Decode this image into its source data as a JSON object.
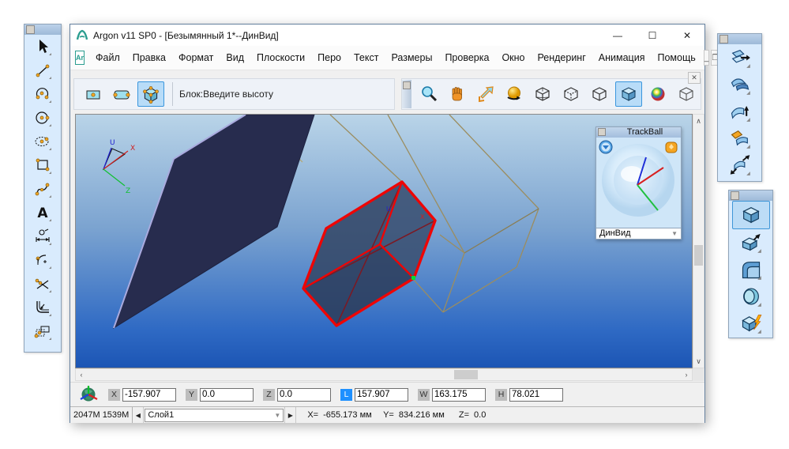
{
  "window": {
    "title": "Argon v11 SP0 - [Безымянный 1*--ДинВид]",
    "controls": {
      "minimize": "—",
      "maximize": "☐",
      "close": "✕"
    }
  },
  "menu": {
    "doc_icon_text": "Ar",
    "items": [
      "Файл",
      "Правка",
      "Формат",
      "Вид",
      "Плоскости",
      "Перо",
      "Текст",
      "Размеры",
      "Проверка",
      "Окно",
      "Рендеринг",
      "Анимация",
      "Помощь"
    ],
    "mdi_minimize": "_",
    "mdi_restore": "❐",
    "mdi_close": "✕"
  },
  "toolbar": {
    "creation_tools": [
      "point-block-icon",
      "two-point-block-icon",
      "block-cube-icon"
    ],
    "selected_creation_tool": "block-cube-icon",
    "prompt": "Блок:Введите высоту",
    "view_tools": [
      "zoom-icon",
      "pan-hand-icon",
      "dynamic-zoom-icon",
      "orbit-icon",
      "wireframe-cube-icon",
      "hidden-line-cube-icon",
      "outline-cube-icon",
      "shaded-cube-icon",
      "render-sphere-icon",
      "ghost-cube-icon"
    ],
    "selected_view_tool": "shaded-cube-icon"
  },
  "left_palette": {
    "tools": [
      "select",
      "line",
      "arc",
      "circle",
      "ellipse",
      "rectangle",
      "spline",
      "text",
      "dimension",
      "curve-edit",
      "trim",
      "fillet",
      "select-region"
    ]
  },
  "right_palette_top": {
    "tools": [
      "extrude-sheet",
      "cover-sheet",
      "lift-sheet",
      "blend-sheet",
      "stretch-sheet"
    ]
  },
  "right_palette_bottom": {
    "tools": [
      "block-solid",
      "extrude-solid",
      "fillet-solid",
      "revolve-solid",
      "boolean-solid"
    ],
    "selected": "block-solid"
  },
  "trackball": {
    "title": "TrackBall",
    "view_mode": "ДинВид"
  },
  "viewport": {
    "axis_labels": {
      "up": "U",
      "right": "X",
      "depth": "Z"
    },
    "box_axis_labels": {
      "up": "U",
      "right": "X"
    },
    "colors": {
      "top": "#b9d4e8",
      "bottom": "#1c55b4",
      "plate": "#272c4e",
      "plate_edge": "#a9aade",
      "wire": "#9b8d60",
      "selection": "#ee0505"
    }
  },
  "coord_bar": {
    "fields": [
      {
        "label": "X",
        "value": "-157.907",
        "active": false
      },
      {
        "label": "Y",
        "value": "0.0",
        "active": false
      },
      {
        "label": "Z",
        "value": "0.0",
        "active": false
      },
      {
        "label": "L",
        "value": "157.907",
        "active": true
      },
      {
        "label": "W",
        "value": "163.175",
        "active": false
      },
      {
        "label": "H",
        "value": "78.021",
        "active": false
      }
    ]
  },
  "status_bar": {
    "memory": "2047M 1539M",
    "layer": "Слой1",
    "x_label": "X=",
    "x_value": "-655.173 мм",
    "y_label": "Y=",
    "y_value": "834.216 мм",
    "z_label": "Z=",
    "z_value": "0.0"
  }
}
